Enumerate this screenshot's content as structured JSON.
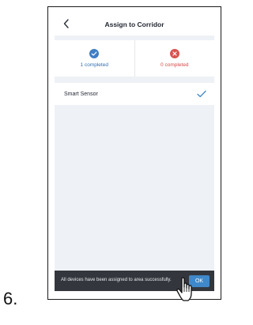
{
  "step_number": "6.",
  "header": {
    "title": "Assign to Corridor",
    "back_icon": "chevron-left-icon"
  },
  "stats": {
    "completed": {
      "label": "1 completed",
      "icon": "check-circle-icon",
      "color": "#2f6fb3"
    },
    "failed": {
      "label": "0 completed",
      "icon": "close-circle-icon",
      "color": "#d24b45"
    }
  },
  "devices": [
    {
      "name": "Smart Sensor",
      "status_icon": "checkmark-icon"
    }
  ],
  "toast": {
    "message": "All devices have been assigned to area successfully.",
    "ok_label": "OK"
  },
  "colors": {
    "accent": "#3f88c9",
    "background": "#eef1f5",
    "toast_background": "#33373d"
  }
}
